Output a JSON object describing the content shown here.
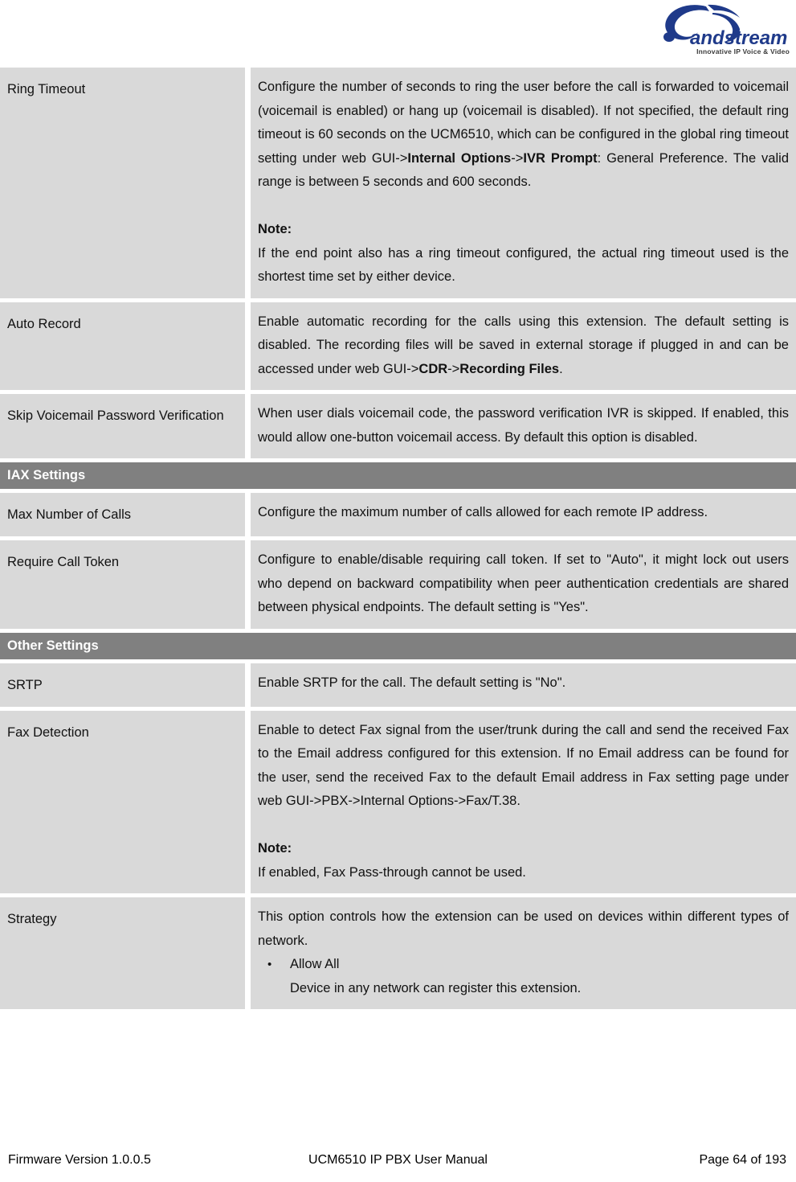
{
  "header": {
    "logo_name": "Grandstream",
    "logo_tagline": "Innovative IP Voice & Video",
    "logo_color": "#1f3a8a"
  },
  "table": {
    "rows": [
      {
        "id": "ring-timeout",
        "label": "Ring Timeout",
        "paragraphs": [
          {
            "type": "justified",
            "runs": [
              {
                "text": "Configure the number of seconds to ring the user before the call is forwarded to voicemail (voicemail is enabled) or hang up (voicemail is disabled). If not specified, the default ring timeout is 60 seconds on the UCM6510, which can be configured in the global ring timeout setting under web GUI->",
                "bold": false
              },
              {
                "text": "Internal Options",
                "bold": true
              },
              {
                "text": "->",
                "bold": false
              },
              {
                "text": "IVR Prompt",
                "bold": true
              },
              {
                "text": ": General Preference. The valid range is between 5 seconds and 600 seconds.",
                "bold": false
              }
            ]
          },
          {
            "type": "blank"
          },
          {
            "type": "plain",
            "runs": [
              {
                "text": "Note:",
                "bold": true
              }
            ]
          },
          {
            "type": "justified",
            "runs": [
              {
                "text": "If the end point also has a ring timeout configured, the actual ring timeout used is the shortest time set by either device.",
                "bold": false
              }
            ]
          }
        ]
      },
      {
        "id": "auto-record",
        "label": "Auto Record",
        "paragraphs": [
          {
            "type": "justified",
            "runs": [
              {
                "text": "Enable automatic recording for the calls using this extension. The default setting is disabled. The recording files will be saved in external storage if plugged in and can be accessed under web GUI->",
                "bold": false
              },
              {
                "text": "CDR",
                "bold": true
              },
              {
                "text": "->",
                "bold": false
              },
              {
                "text": "Recording Files",
                "bold": true
              },
              {
                "text": ".",
                "bold": false
              }
            ]
          }
        ]
      },
      {
        "id": "skip-voicemail-password-verification",
        "label": "Skip Voicemail Password Verification",
        "paragraphs": [
          {
            "type": "justified",
            "runs": [
              {
                "text": "When user dials voicemail code, the password verification IVR is skipped. If enabled, this would allow one-button voicemail access. By default this option is disabled.",
                "bold": false
              }
            ]
          }
        ]
      }
    ],
    "section_iax": {
      "title": "IAX Settings",
      "rows": [
        {
          "id": "max-number-of-calls",
          "label": "Max Number of Calls",
          "paragraphs": [
            {
              "type": "justified",
              "runs": [
                {
                  "text": "Configure the maximum number of calls allowed for each remote IP address.",
                  "bold": false
                }
              ]
            }
          ]
        },
        {
          "id": "require-call-token",
          "label": "Require Call Token",
          "paragraphs": [
            {
              "type": "justified",
              "runs": [
                {
                  "text": "Configure to enable/disable requiring call token. If set to \"Auto\", it might lock out users who depend on backward compatibility when peer authentication credentials are shared between physical endpoints. The default setting is \"Yes\".",
                  "bold": false
                }
              ]
            }
          ]
        }
      ]
    },
    "section_other": {
      "title": "Other Settings",
      "rows": [
        {
          "id": "srtp",
          "label": "SRTP",
          "paragraphs": [
            {
              "type": "plain",
              "runs": [
                {
                  "text": "Enable SRTP for the call. The default setting is \"No\".",
                  "bold": false
                }
              ]
            }
          ]
        },
        {
          "id": "fax-detection",
          "label": "Fax Detection",
          "paragraphs": [
            {
              "type": "justified",
              "runs": [
                {
                  "text": "Enable to detect Fax signal from the user/trunk during the call and send the received Fax to the Email address configured for this extension. If no Email address can be found for the user, send the received Fax to the default Email address in Fax setting page under web GUI->PBX->Internal Options->Fax/T.38.",
                  "bold": false
                }
              ]
            },
            {
              "type": "blank"
            },
            {
              "type": "plain",
              "runs": [
                {
                  "text": "Note:",
                  "bold": true
                }
              ]
            },
            {
              "type": "plain",
              "runs": [
                {
                  "text": "If enabled, Fax Pass-through cannot be used.",
                  "bold": false
                }
              ]
            }
          ]
        },
        {
          "id": "strategy",
          "label": "Strategy",
          "paragraphs": [
            {
              "type": "justified",
              "runs": [
                {
                  "text": "This option controls how the extension can be used on devices within different types of network.",
                  "bold": false
                }
              ]
            },
            {
              "type": "bullet",
              "bullet": "•",
              "runs": [
                {
                  "text": "Allow All",
                  "bold": false
                }
              ]
            },
            {
              "type": "subline",
              "runs": [
                {
                  "text": "Device in any network can register this extension.",
                  "bold": false
                }
              ]
            }
          ]
        }
      ]
    }
  },
  "footer": {
    "left": "Firmware Version 1.0.0.5",
    "center": "UCM6510 IP PBX User Manual",
    "right": "Page 64 of 193"
  }
}
